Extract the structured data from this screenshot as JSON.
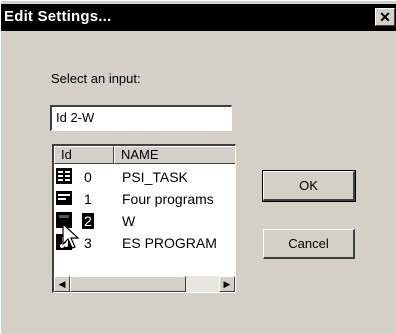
{
  "window": {
    "title": "Edit Settings...",
    "close_glyph": "✕"
  },
  "prompt": "Select an input:",
  "input": {
    "value": "Id 2-W"
  },
  "list": {
    "columns": [
      "Id",
      "NAME"
    ],
    "rows": [
      {
        "id": "0",
        "name": "PSI_TASK",
        "icon": "task-icon"
      },
      {
        "id": "1",
        "name": "Four programs",
        "icon": "stack-icon"
      },
      {
        "id": "2",
        "name": "W",
        "icon": "program-icon",
        "selected": true
      },
      {
        "id": "3",
        "name": "ES PROGRAM",
        "icon": "music-icon"
      }
    ]
  },
  "buttons": {
    "ok": "OK",
    "cancel": "Cancel"
  },
  "scrollbar": {
    "left_glyph": "◀",
    "right_glyph": "▶"
  }
}
